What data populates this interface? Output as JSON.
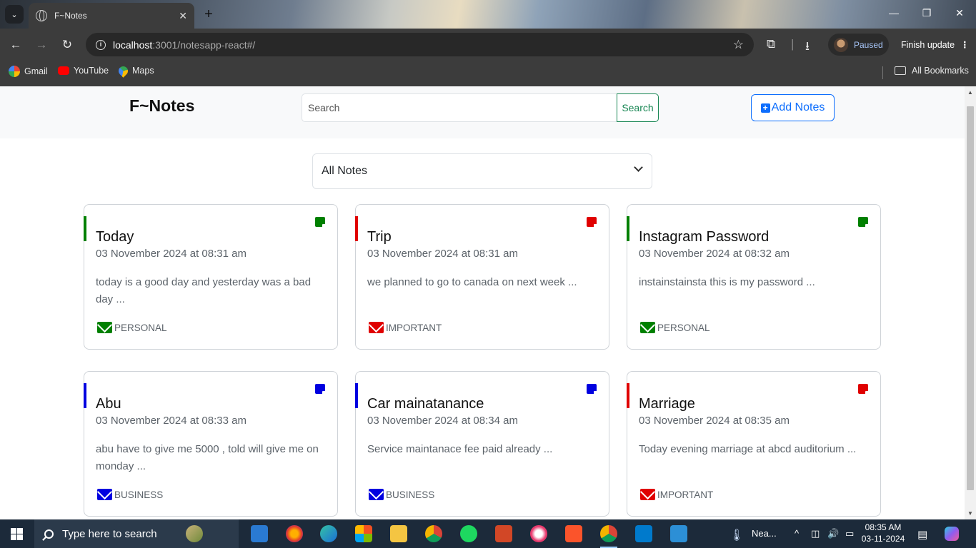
{
  "browser": {
    "tab_title": "F~Notes",
    "url_host": "localhost",
    "url_rest": ":3001/notesapp-react#/",
    "profile_status": "Paused",
    "update_label": "Finish update",
    "bookmarks": [
      "Gmail",
      "YouTube",
      "Maps"
    ],
    "all_bookmarks_label": "All Bookmarks"
  },
  "app": {
    "brand": "F~Notes",
    "search_placeholder": "Search",
    "search_button": "Search",
    "add_button": "Add Notes",
    "filter_selected": "All Notes"
  },
  "notes": [
    {
      "title": "Today",
      "date": "03 November 2024 at 08:31 am",
      "body": "today is a good day and yesterday was a bad day ...",
      "tag": "PERSONAL",
      "color": "#008000"
    },
    {
      "title": "Trip",
      "date": "03 November 2024 at 08:31 am",
      "body": "we planned to go to canada on next week ...",
      "tag": "IMPORTANT",
      "color": "#e00000"
    },
    {
      "title": "Instagram Password",
      "date": "03 November 2024 at 08:32 am",
      "body": "instainstainsta this is my password ...",
      "tag": "PERSONAL",
      "color": "#008000"
    },
    {
      "title": "Abu",
      "date": "03 November 2024 at 08:33 am",
      "body": "abu have to give me 5000 , told will give me on monday ...",
      "tag": "BUSINESS",
      "color": "#0000e0"
    },
    {
      "title": "Car mainatanance",
      "date": "03 November 2024 at 08:34 am",
      "body": "Service maintanace fee paid already ...",
      "tag": "BUSINESS",
      "color": "#0000e0"
    },
    {
      "title": "Marriage",
      "date": "03 November 2024 at 08:35 am",
      "body": "Today evening marriage at abcd auditorium ...",
      "tag": "IMPORTANT",
      "color": "#e00000"
    }
  ],
  "taskbar": {
    "search_placeholder": "Type here to search",
    "weather_text": "Nea...",
    "time": "08:35 AM",
    "date": "03-11-2024"
  }
}
